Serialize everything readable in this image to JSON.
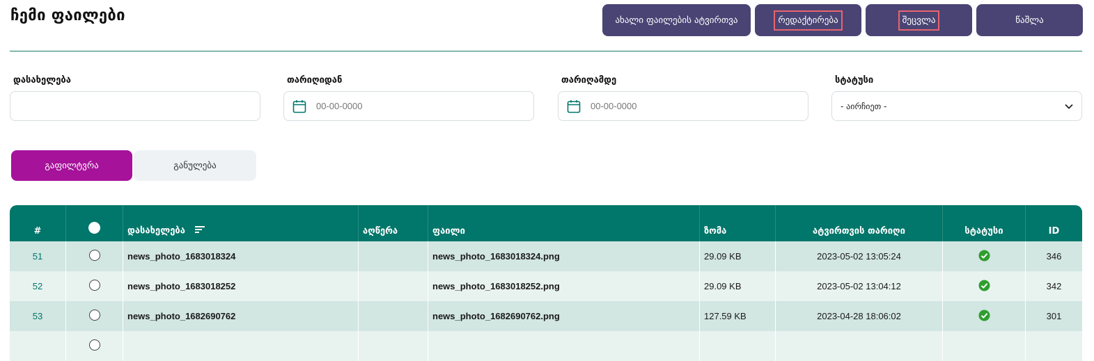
{
  "page": {
    "title": "ჩემი ფაილები"
  },
  "toolbar": {
    "upload_label": "ახალი ფაილების ატვირთვა",
    "edit_label": "რედაქტირება",
    "change_label": "შეცვლა",
    "delete_label": "წაშლა"
  },
  "filters": {
    "name": {
      "label": "დასახელება",
      "value": ""
    },
    "date_from": {
      "label": "თარიღიდან",
      "placeholder": "00-00-0000"
    },
    "date_to": {
      "label": "თარიღამდე",
      "placeholder": "00-00-0000"
    },
    "status": {
      "label": "სტატუსი",
      "selected": "- აირჩიეთ -"
    }
  },
  "buttons": {
    "filter_label": "გაფილტვრა",
    "reset_label": "განულება"
  },
  "table": {
    "headers": {
      "num": "#",
      "name": "დასახელება",
      "description": "აღწერა",
      "file": "ფაილი",
      "size": "ზომა",
      "upload_date": "ატვირთვის თარიღი",
      "status": "სტატუსი",
      "id": "ID"
    },
    "rows": [
      {
        "num": "51",
        "name": "news_photo_1683018324",
        "description": "",
        "file": "news_photo_1683018324.png",
        "size": "29.09 KB",
        "upload_date": "2023-05-02 13:05:24",
        "id": "346"
      },
      {
        "num": "52",
        "name": "news_photo_1683018252",
        "description": "",
        "file": "news_photo_1683018252.png",
        "size": "29.09 KB",
        "upload_date": "2023-05-02 13:04:12",
        "id": "342"
      },
      {
        "num": "53",
        "name": "news_photo_1682690762",
        "description": "",
        "file": "news_photo_1682690762.png",
        "size": "127.59 KB",
        "upload_date": "2023-04-28 18:06:02",
        "id": "301"
      }
    ]
  },
  "colors": {
    "primary": "#01766a",
    "toolbar": "#4a4474",
    "filter_button": "#a6129a",
    "status_ok": "#2e9e2e"
  }
}
